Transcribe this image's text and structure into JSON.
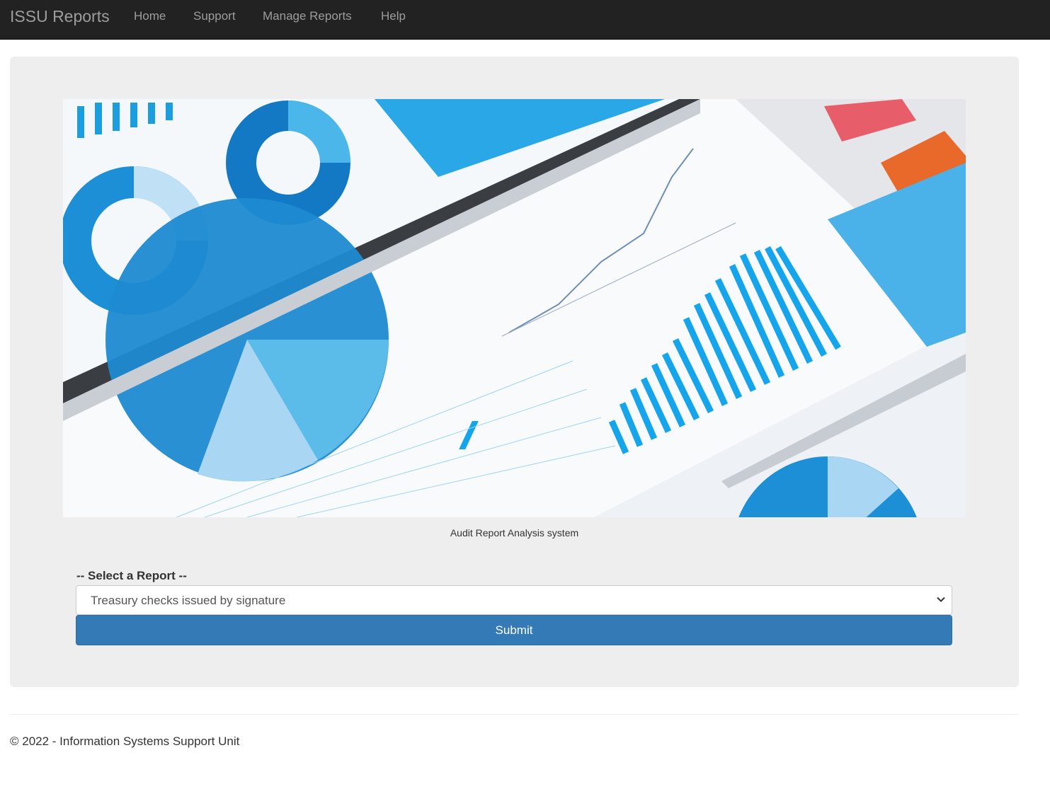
{
  "navbar": {
    "brand": "ISSU Reports",
    "links": [
      {
        "label": "Home"
      },
      {
        "label": "Support"
      },
      {
        "label": "Manage Reports"
      },
      {
        "label": "Help"
      }
    ]
  },
  "hero": {
    "image_icon": "dashboard-analytics-photo",
    "caption": "Audit Report Analysis system"
  },
  "form": {
    "select_label": "-- Select a Report --",
    "selected_report": "Treasury checks issued by signature",
    "submit_label": "Submit",
    "chevron_icon": "chevron-down-icon"
  },
  "footer": {
    "text": "© 2022 - Information Systems Support Unit"
  },
  "colors": {
    "navbar_bg": "#222222",
    "nav_text": "#9d9d9d",
    "panel_bg": "#eeeeee",
    "primary": "#337ab7"
  }
}
